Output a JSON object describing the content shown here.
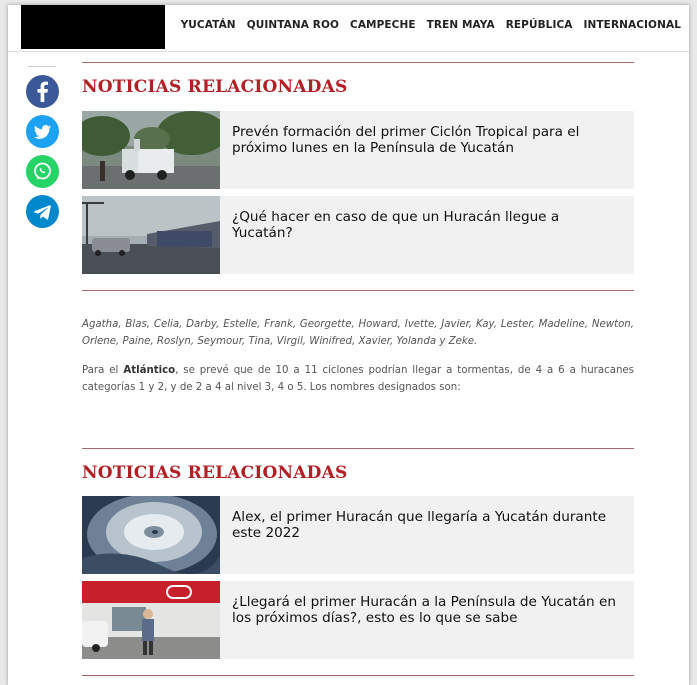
{
  "nav": {
    "items": [
      "YUCATÁN",
      "QUINTANA ROO",
      "CAMPECHE",
      "TREN MAYA",
      "REPÚBLICA",
      "INTERNACIONAL"
    ]
  },
  "share": {
    "icons": [
      "facebook-icon",
      "twitter-icon",
      "whatsapp-icon",
      "telegram-icon"
    ],
    "colors": {
      "facebook": "#3b5998",
      "twitter": "#1da1f2",
      "whatsapp": "#25d366",
      "telegram": "#0088cc"
    }
  },
  "related": [
    {
      "heading": "NOTICIAS RELACIONADAS",
      "items": [
        {
          "title": "Prevén formación del primer Ciclón Tropical para el próximo lunes en la Península de Yucatán"
        },
        {
          "title": "¿Qué hacer en caso de que un Huracán llegue a Yucatán?"
        }
      ]
    },
    {
      "heading": "NOTICIAS RELACIONADAS",
      "items": [
        {
          "title": "Alex, el primer Huracán que llegaría a Yucatán durante este 2022"
        },
        {
          "title": "¿Llegará el primer Huracán a la Península de Yucatán en los próximos días?, esto es lo que se sabe"
        }
      ]
    }
  ],
  "article": {
    "names_list": "Agatha, Blas, Celia, Darby, Estelle, Frank, Georgette, Howard, Ivette, Javier, Kay, Lester, Madeline, Newton, Orlene, Paine, Roslyn, Seymour, Tina, Virgil, Winifred, Xavier, Yolanda y Zeke.",
    "atlantic_prefix": "Para el ",
    "atlantic_bold": "Atlántico",
    "atlantic_rest": ", se prevé que de 10 a 11 ciclones podrían llegar a tormentas, de 4 a 6 a huracanes categorías 1 y 2, y de 2 a 4 al nivel 3, 4 o 5. Los nombres designados son:"
  },
  "colors": {
    "accent": "#b21f24"
  }
}
